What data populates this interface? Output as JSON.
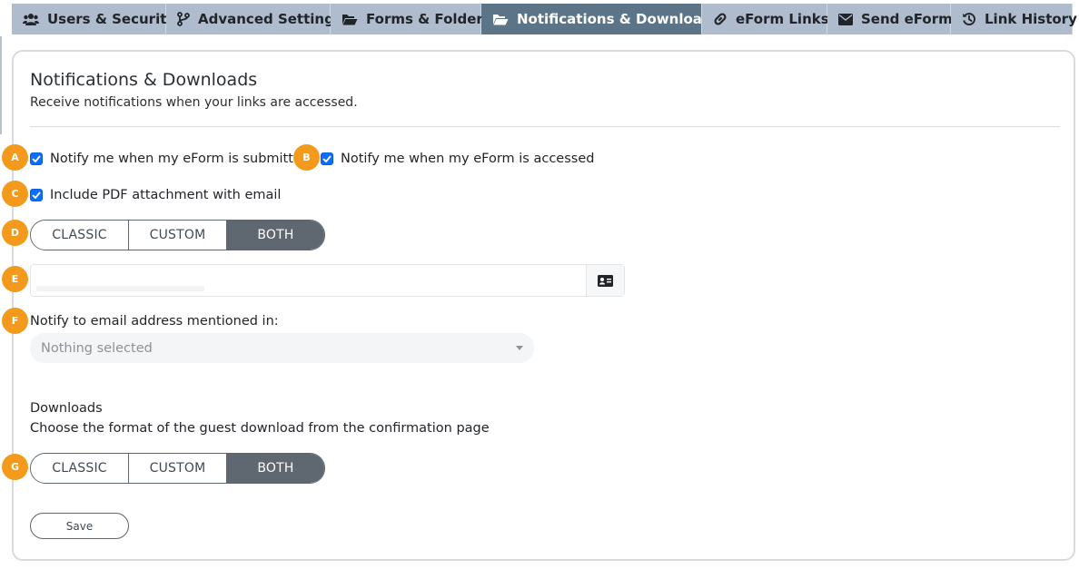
{
  "tabs": [
    {
      "label": "Users & Security",
      "icon": "users-icon",
      "active": false
    },
    {
      "label": "Advanced Settings",
      "icon": "branch-icon",
      "active": false
    },
    {
      "label": "Forms & Folders",
      "icon": "folder-open-icon",
      "active": false
    },
    {
      "label": "Notifications & Downloads",
      "icon": "folder-open-icon",
      "active": true
    },
    {
      "label": "eForm Links",
      "icon": "link-icon",
      "active": false
    },
    {
      "label": "Send eForm",
      "icon": "envelope-icon",
      "active": false
    },
    {
      "label": "Link History",
      "icon": "history-icon",
      "active": false
    }
  ],
  "section": {
    "title": "Notifications & Downloads",
    "subtitle": "Receive notifications when your links are accessed."
  },
  "notifications": {
    "notify_submitted_label": "Notify me when my eForm is submitted",
    "notify_submitted_checked": true,
    "notify_accessed_label": "Notify me when my eForm is accessed",
    "notify_accessed_checked": true,
    "include_pdf_label": "Include PDF attachment with email",
    "include_pdf_checked": true,
    "format_options": [
      "CLASSIC",
      "CUSTOM",
      "BOTH"
    ],
    "format_selected": "BOTH",
    "email_value": "",
    "notify_to_label": "Notify to email address mentioned in:",
    "notify_to_placeholder": "Nothing selected"
  },
  "downloads": {
    "heading": "Downloads",
    "description": "Choose the format of the guest download from the confirmation page",
    "format_options": [
      "CLASSIC",
      "CUSTOM",
      "BOTH"
    ],
    "format_selected": "BOTH"
  },
  "save_label": "Save",
  "markers": [
    "A",
    "B",
    "C",
    "D",
    "E",
    "F",
    "G"
  ],
  "colors": {
    "tab_bg": "#aebccd",
    "tab_active_bg": "#5b7488",
    "checkbox": "#0d6efd",
    "segment_active": "#5f6770",
    "marker": "#f39a1c"
  }
}
